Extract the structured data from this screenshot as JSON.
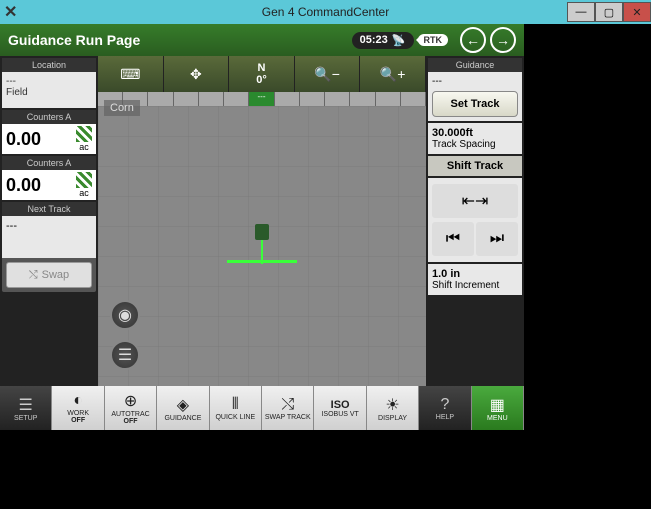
{
  "window": {
    "title": "Gen 4 CommandCenter"
  },
  "header": {
    "page_title": "Guidance Run Page",
    "time": "05:23",
    "signal": "RTK"
  },
  "left": {
    "location": {
      "header": "Location",
      "line1": "---",
      "line2": "Field"
    },
    "counters": [
      {
        "header": "Counters A",
        "value": "0.00",
        "unit": "ac"
      },
      {
        "header": "Counters A",
        "value": "0.00",
        "unit": "ac"
      }
    ],
    "next_track": {
      "header": "Next Track",
      "value": "---"
    },
    "swap_label": "Swap"
  },
  "center": {
    "heading_dir": "N",
    "heading_deg": "0°",
    "ruler_value": "---",
    "crop_label": "Corn"
  },
  "right": {
    "guidance_header": "Guidance",
    "guidance_value": "---",
    "set_track_label": "Set Track",
    "track_spacing_val": "30.000ft",
    "track_spacing_lbl": "Track Spacing",
    "shift_header": "Shift Track",
    "shift_inc_val": "1.0 in",
    "shift_inc_lbl": "Shift Increment"
  },
  "bottom": {
    "setup": "SETUP",
    "work": "WORK",
    "work_sub": "OFF",
    "autotrac": "AUTOTRAC",
    "autotrac_sub": "OFF",
    "guidance": "GUIDANCE",
    "quickline": "QUICK LINE",
    "swaptrack": "SWAP TRACK",
    "isobus": "ISOBUS VT",
    "isobus_icon": "ISO",
    "display": "DISPLAY",
    "help": "HELP",
    "menu": "MENU"
  }
}
